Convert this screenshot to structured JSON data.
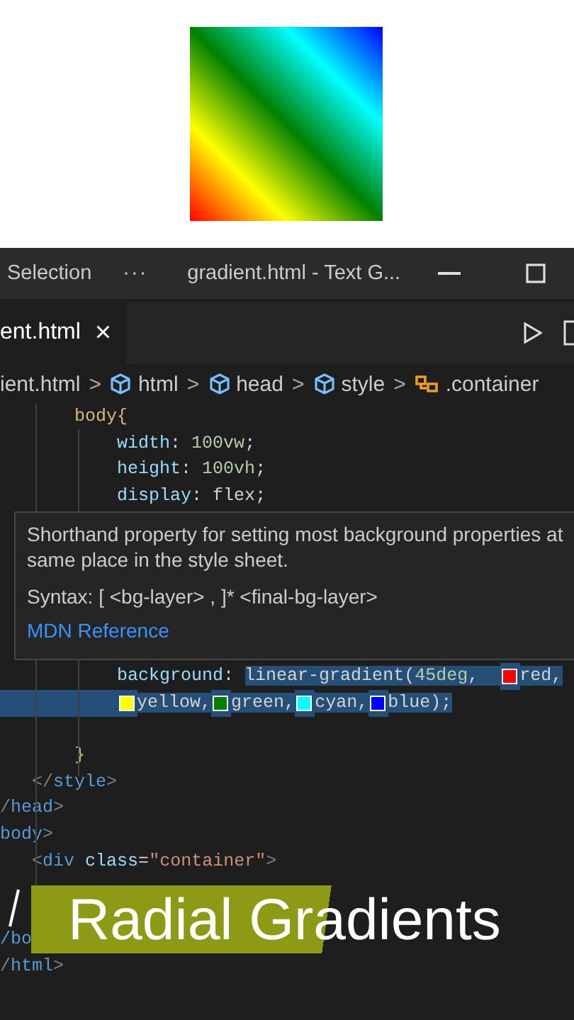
{
  "preview": {
    "kind": "gradient-square"
  },
  "title_bar": {
    "menu": "Selection",
    "more": "···",
    "title": "gradient.html - Text G..."
  },
  "tabs": [
    {
      "label": "ent.html",
      "close": "×",
      "selected": true
    }
  ],
  "breadcrumb": [
    {
      "label": "ient.html",
      "kind": "file"
    },
    {
      "label": "html",
      "kind": "element",
      "separator": ">"
    },
    {
      "label": "head",
      "kind": "element",
      "separator": ">"
    },
    {
      "label": "style",
      "kind": "element",
      "separator": ">"
    },
    {
      "label": ".container",
      "kind": "selector",
      "separator": ">"
    }
  ],
  "code_before_hover": [
    {
      "kind": "code",
      "tokens": [
        {
          "text": "       body",
          "kind": "selector",
          "selected": false
        },
        {
          "text": "{",
          "kind": "selector",
          "selected": false
        }
      ]
    },
    {
      "kind": "code",
      "tokens": [
        {
          "text": "           width",
          "kind": "property",
          "selected": false
        },
        {
          "text": ": ",
          "kind": "punct",
          "selected": false
        },
        {
          "text": "100vw",
          "kind": "number",
          "selected": false
        },
        {
          "text": ";",
          "kind": "punct",
          "selected": false
        }
      ]
    },
    {
      "kind": "code",
      "tokens": [
        {
          "text": "           height",
          "kind": "property",
          "selected": false
        },
        {
          "text": ": ",
          "kind": "punct",
          "selected": false
        },
        {
          "text": "100vh",
          "kind": "number",
          "selected": false
        },
        {
          "text": ";",
          "kind": "punct",
          "selected": false
        }
      ]
    },
    {
      "kind": "code",
      "tokens": [
        {
          "text": "           display",
          "kind": "property",
          "selected": false
        },
        {
          "text": ": ",
          "kind": "punct",
          "selected": false
        },
        {
          "text": "flex",
          "kind": "value",
          "selected": false
        },
        {
          "text": ";",
          "kind": "punct",
          "selected": false
        }
      ]
    }
  ],
  "hover": {
    "description": "Shorthand property for setting most background properties at",
    "description_2": "same place in the style sheet.",
    "syntax": "Syntax: [ <bg-layer> , ]* <final-bg-layer>",
    "link": "MDN Reference"
  },
  "code_after_hover": [
    {
      "kind": "code",
      "tokens": [
        {
          "text": "           background",
          "kind": "property",
          "selected": false
        },
        {
          "text": ": ",
          "kind": "punct",
          "selected": false
        },
        {
          "text": "linear-gradient",
          "kind": "value",
          "selected": true
        },
        {
          "text": "(",
          "kind": "punct",
          "selected": true
        },
        {
          "text": "45deg",
          "kind": "number",
          "selected": true
        },
        {
          "text": ",  ",
          "kind": "punct",
          "selected": true
        },
        {
          "kind": "swatch",
          "color": "#ff0000",
          "selected": true
        },
        {
          "text": "red",
          "kind": "value",
          "selected": true
        },
        {
          "text": ",",
          "kind": "punct",
          "selected": true
        }
      ]
    },
    {
      "kind": "code",
      "tokens": [
        {
          "kind": "indent",
          "selected": true
        },
        {
          "kind": "swatch",
          "color": "#ffff00",
          "selected": true
        },
        {
          "text": "yellow",
          "kind": "value",
          "selected": true
        },
        {
          "text": ",",
          "kind": "punct",
          "selected": true
        },
        {
          "kind": "swatch",
          "color": "#008000",
          "selected": true
        },
        {
          "text": "green",
          "kind": "value",
          "selected": true
        },
        {
          "text": ",",
          "kind": "punct",
          "selected": true
        },
        {
          "kind": "swatch",
          "color": "#00ffff",
          "selected": true
        },
        {
          "text": "cyan",
          "kind": "value",
          "selected": true
        },
        {
          "text": ",",
          "kind": "punct",
          "selected": true
        },
        {
          "kind": "swatch",
          "color": "#0000ff",
          "selected": true
        },
        {
          "text": "blue",
          "kind": "value",
          "selected": true
        },
        {
          "text": ");",
          "kind": "punct",
          "selected": true
        }
      ]
    },
    {
      "kind": "blank"
    },
    {
      "kind": "code",
      "tokens": [
        {
          "text": "       }",
          "kind": "selector",
          "selected": false
        }
      ]
    },
    {
      "kind": "code",
      "tokens": [
        {
          "text": "   </",
          "kind": "tagbr",
          "selected": false
        },
        {
          "text": "style",
          "kind": "tag",
          "selected": false
        },
        {
          "text": ">",
          "kind": "tagbr",
          "selected": false
        }
      ]
    },
    {
      "kind": "code",
      "tokens": [
        {
          "text": "/",
          "kind": "tagbr",
          "selected": false
        },
        {
          "text": "head",
          "kind": "tag",
          "selected": false
        },
        {
          "text": ">",
          "kind": "tagbr",
          "selected": false
        }
      ]
    },
    {
      "kind": "code",
      "tokens": [
        {
          "text": "body",
          "kind": "tag",
          "selected": false
        },
        {
          "text": ">",
          "kind": "tagbr",
          "selected": false
        }
      ]
    },
    {
      "kind": "code",
      "tokens": [
        {
          "text": "   <",
          "kind": "tagbr",
          "selected": false
        },
        {
          "text": "div",
          "kind": "tag",
          "selected": false
        },
        {
          "text": " class",
          "kind": "attr",
          "selected": false
        },
        {
          "text": "=",
          "kind": "punct",
          "selected": false
        },
        {
          "text": "\"container\"",
          "kind": "string",
          "selected": false
        },
        {
          "text": ">",
          "kind": "tagbr",
          "selected": false
        }
      ]
    },
    {
      "kind": "blank"
    },
    {
      "kind": "blank"
    },
    {
      "kind": "code",
      "tokens": [
        {
          "text": "/bo",
          "kind": "tag",
          "selected": false
        }
      ]
    },
    {
      "kind": "code",
      "tokens": [
        {
          "text": "/",
          "kind": "tagbr",
          "selected": false
        },
        {
          "text": "html",
          "kind": "tag",
          "selected": false
        },
        {
          "text": ">",
          "kind": "tagbr",
          "selected": false
        }
      ]
    }
  ],
  "caption": {
    "text": "Radial Gradients"
  }
}
